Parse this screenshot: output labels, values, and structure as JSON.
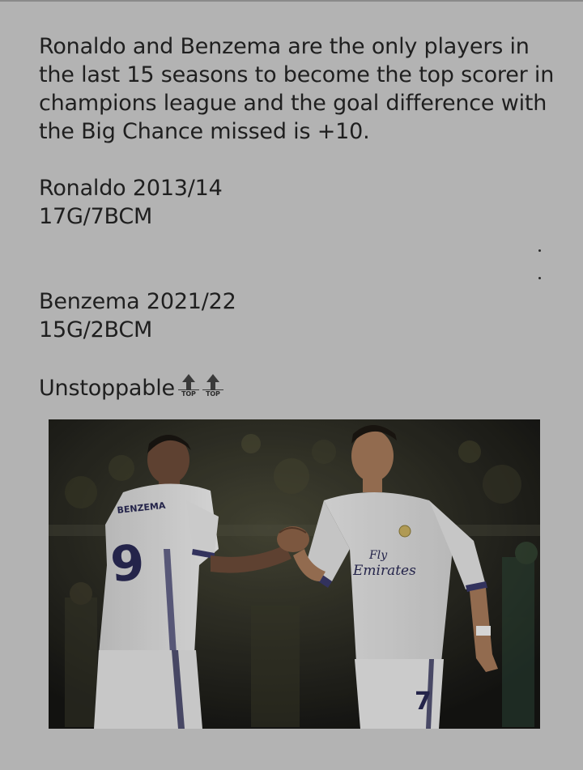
{
  "post": {
    "paragraph1": "Ronaldo and Benzema are the only players in the last 15 seasons to become the top scorer in champions league and the goal difference with the Big Chance missed is +10.",
    "ronaldo_season": "Ronaldo 2013/14",
    "ronaldo_stats": "17G/7BCM",
    "benzema_season": "Benzema 2021/22",
    "benzema_stats": "15G/2BCM",
    "closing_word": "Unstoppable",
    "emoji_label_1": "TOP",
    "emoji_label_2": "TOP",
    "emoji_name": "top-arrow-icon"
  },
  "image": {
    "description_alt": "Benzema and Ronaldo shaking hands in white Real Madrid kits",
    "jersey_back_name": "BENZEMA",
    "jersey_back_number": "9",
    "sponsor_line1": "Fly",
    "sponsor_line2": "Emirates",
    "shorts_number": "7"
  },
  "colors": {
    "background": "#b3b3b3",
    "text": "#1f1f1f"
  }
}
